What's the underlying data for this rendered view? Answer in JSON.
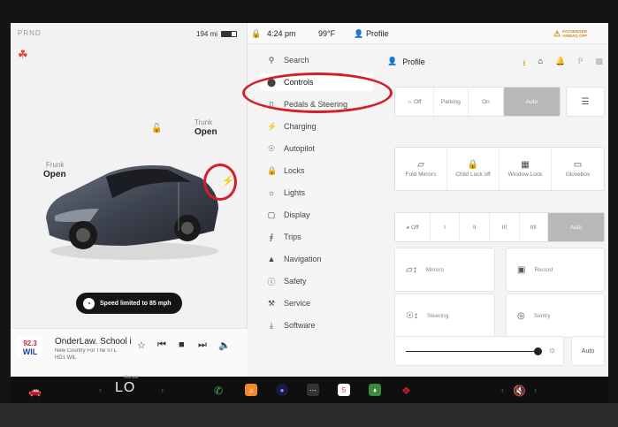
{
  "car_status": {
    "gear": "PRND",
    "range": "194 mi",
    "battery_level": 0.7,
    "trunk_label": "Trunk",
    "trunk_state": "Open",
    "frunk_label": "Frunk",
    "frunk_state": "Open",
    "speed_limit_text": "Speed limited to 85 mph"
  },
  "media": {
    "station_logo_text": "92.3",
    "station_logo_sub": "WIL",
    "title": "OnderLaw. School i",
    "subtitle": "New Country For The STL",
    "channel": "HD1 WIL"
  },
  "status_bar": {
    "time": "4:24 pm",
    "temperature": "99°F",
    "profile": "Profile",
    "airbag_label": "PASSENGER AIRBAG OFF"
  },
  "menu": {
    "items": [
      {
        "label": "Search",
        "icon": "search-icon"
      },
      {
        "label": "Controls",
        "icon": "toggle-icon"
      },
      {
        "label": "Pedals & Steering",
        "icon": "car-icon"
      },
      {
        "label": "Charging",
        "icon": "bolt-icon"
      },
      {
        "label": "Autopilot",
        "icon": "steering-wheel-icon"
      },
      {
        "label": "Locks",
        "icon": "lock-icon"
      },
      {
        "label": "Lights",
        "icon": "sun-icon"
      },
      {
        "label": "Display",
        "icon": "display-icon"
      },
      {
        "label": "Trips",
        "icon": "trips-icon"
      },
      {
        "label": "Navigation",
        "icon": "navigation-icon"
      },
      {
        "label": "Safety",
        "icon": "safety-icon"
      },
      {
        "label": "Service",
        "icon": "wrench-icon"
      },
      {
        "label": "Software",
        "icon": "download-icon"
      }
    ],
    "active": "Controls"
  },
  "controls": {
    "profile_label": "Profile",
    "headlights": [
      "Off",
      "Parking",
      "On",
      "Auto"
    ],
    "headlights_selected": "Auto",
    "quick": [
      {
        "label": "Fold Mirrors",
        "icon": "mirror-icon"
      },
      {
        "label": "Child Lock off",
        "icon": "child-lock-icon"
      },
      {
        "label": "Window Lock",
        "icon": "window-lock-icon"
      },
      {
        "label": "Glovebox",
        "icon": "glovebox-icon"
      }
    ],
    "wipers": [
      "Off",
      "I",
      "II",
      "III",
      "IIII",
      "Auto"
    ],
    "wipers_selected": "Auto",
    "mirrors_label": "Mirrors",
    "steering_label": "Steering",
    "record_label": "Record",
    "sentry_label": "Sentry",
    "brightness_auto": "Auto"
  },
  "dock": {
    "temp_mode": "Manual",
    "temp_value": "LO",
    "calendar_day": "5"
  }
}
